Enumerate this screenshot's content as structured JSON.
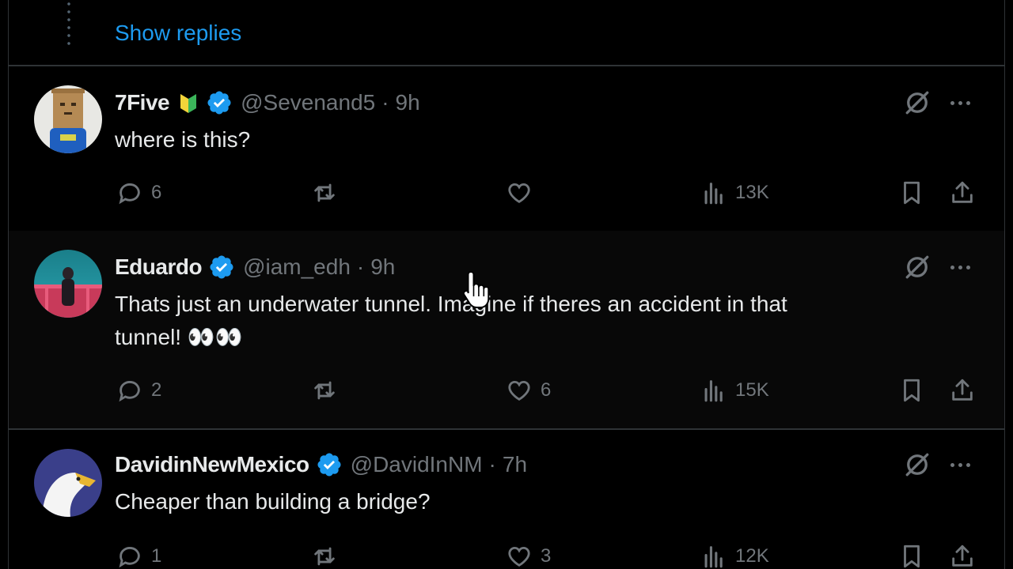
{
  "thread": {
    "show_replies": "Show replies"
  },
  "tweets": [
    {
      "name": "7Five",
      "handle": "@Sevenand5",
      "time": "9h",
      "text_lines": [
        "where is this?"
      ],
      "replies": "6",
      "retweets": "",
      "likes": "",
      "views": "13K"
    },
    {
      "name": "Eduardo",
      "handle": "@iam_edh",
      "time": "9h",
      "text_lines": [
        "Thats just an underwater tunnel. Imagine if theres an accident in that",
        "tunnel! 👀👀"
      ],
      "replies": "2",
      "retweets": "",
      "likes": "6",
      "views": "15K"
    },
    {
      "name": "DavidinNewMexico",
      "handle": "@DavidInNM",
      "time": "7h",
      "text_lines": [
        "Cheaper than building a bridge?"
      ],
      "replies": "1",
      "retweets": "",
      "likes": "3",
      "views": "12K"
    }
  ],
  "colors": {
    "accent": "#1d9bf0",
    "muted": "#71767b",
    "text": "#e7e9ea",
    "border": "#2f3336"
  }
}
